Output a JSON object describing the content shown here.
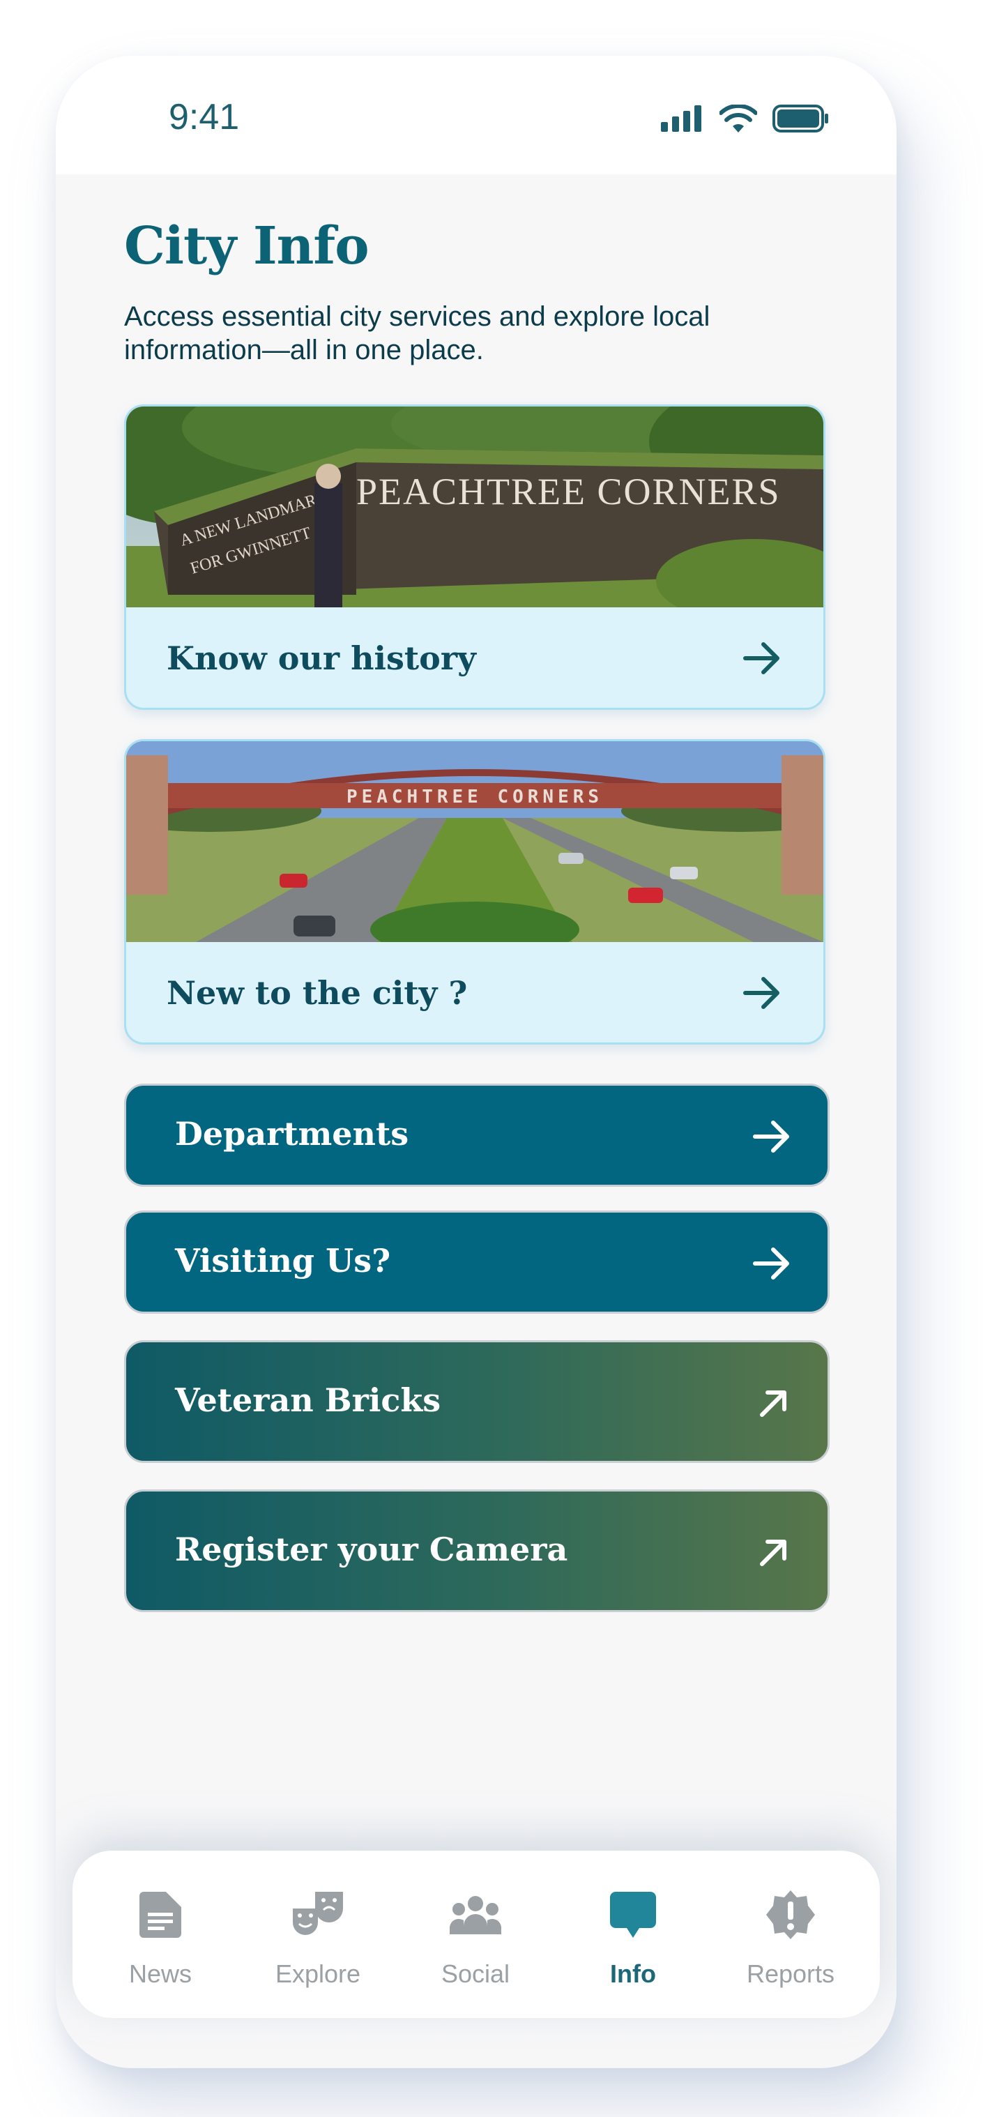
{
  "status_bar": {
    "time": "9:41"
  },
  "header": {
    "title": "City Info",
    "subtitle": "Access essential city services and explore local information—all in one place."
  },
  "cards": [
    {
      "label": "Know our history",
      "image_sign_text": [
        "A NEW LANDMARK",
        "FOR GWINNETT",
        "PEACHTREE CORNERS"
      ]
    },
    {
      "label": "New to the city ?",
      "image_sign_text": [
        "PEACHTREE CORNERS"
      ]
    }
  ],
  "buttons": [
    {
      "label": "Departments",
      "icon": "arrow-right-icon"
    },
    {
      "label": "Visiting Us?",
      "icon": "arrow-right-icon"
    },
    {
      "label": "Veteran Bricks",
      "icon": "arrow-up-right-icon"
    },
    {
      "label": "Register your Camera",
      "icon": "arrow-up-right-icon"
    }
  ],
  "tab_bar": {
    "tabs": [
      {
        "label": "News",
        "icon": "document-icon"
      },
      {
        "label": "Explore",
        "icon": "theater-masks-icon"
      },
      {
        "label": "Social",
        "icon": "people-group-icon"
      },
      {
        "label": "Info",
        "icon": "chat-bubble-icon",
        "active": true
      },
      {
        "label": "Reports",
        "icon": "alert-badge-icon"
      }
    ]
  },
  "colors": {
    "accent": "#0c6376",
    "button_teal": "#026680",
    "card_bg": "#dcf3fc",
    "tab_inactive": "#9aa0a4"
  }
}
